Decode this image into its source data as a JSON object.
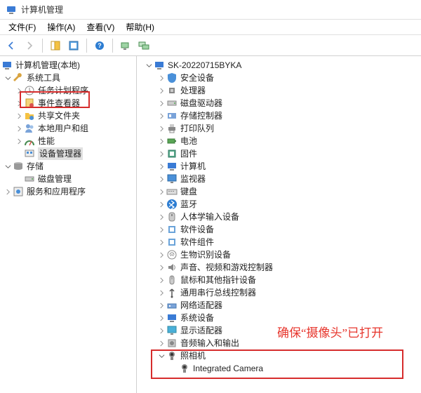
{
  "window": {
    "title": "计算机管理"
  },
  "menubar": [
    "文件(F)",
    "操作(A)",
    "查看(V)",
    "帮助(H)"
  ],
  "left_tree": {
    "root": {
      "label": "计算机管理(本地)"
    },
    "system_tools": {
      "label": "系统工具",
      "children": [
        {
          "label": "任务计划程序"
        },
        {
          "label": "事件查看器"
        },
        {
          "label": "共享文件夹"
        },
        {
          "label": "本地用户和组"
        },
        {
          "label": "性能"
        },
        {
          "label": "设备管理器",
          "selected": true
        }
      ]
    },
    "storage": {
      "label": "存储",
      "children": [
        {
          "label": "磁盘管理"
        }
      ]
    },
    "services": {
      "label": "服务和应用程序"
    }
  },
  "right_tree": {
    "root": {
      "label": "SK-20220715BYKA"
    },
    "items": [
      {
        "label": "安全设备"
      },
      {
        "label": "处理器"
      },
      {
        "label": "磁盘驱动器"
      },
      {
        "label": "存储控制器"
      },
      {
        "label": "打印队列"
      },
      {
        "label": "电池"
      },
      {
        "label": "固件"
      },
      {
        "label": "计算机"
      },
      {
        "label": "监视器"
      },
      {
        "label": "键盘"
      },
      {
        "label": "蓝牙"
      },
      {
        "label": "人体学输入设备"
      },
      {
        "label": "软件设备"
      },
      {
        "label": "软件组件"
      },
      {
        "label": "生物识别设备"
      },
      {
        "label": "声音、视频和游戏控制器"
      },
      {
        "label": "鼠标和其他指针设备"
      },
      {
        "label": "通用串行总线控制器"
      },
      {
        "label": "网络适配器"
      },
      {
        "label": "系统设备"
      },
      {
        "label": "显示适配器"
      },
      {
        "label": "音频输入和输出"
      },
      {
        "label": "照相机",
        "expanded": true
      }
    ],
    "camera_child": {
      "label": "Integrated Camera"
    }
  },
  "annotation": {
    "text": "确保“摄像头”已打开"
  }
}
